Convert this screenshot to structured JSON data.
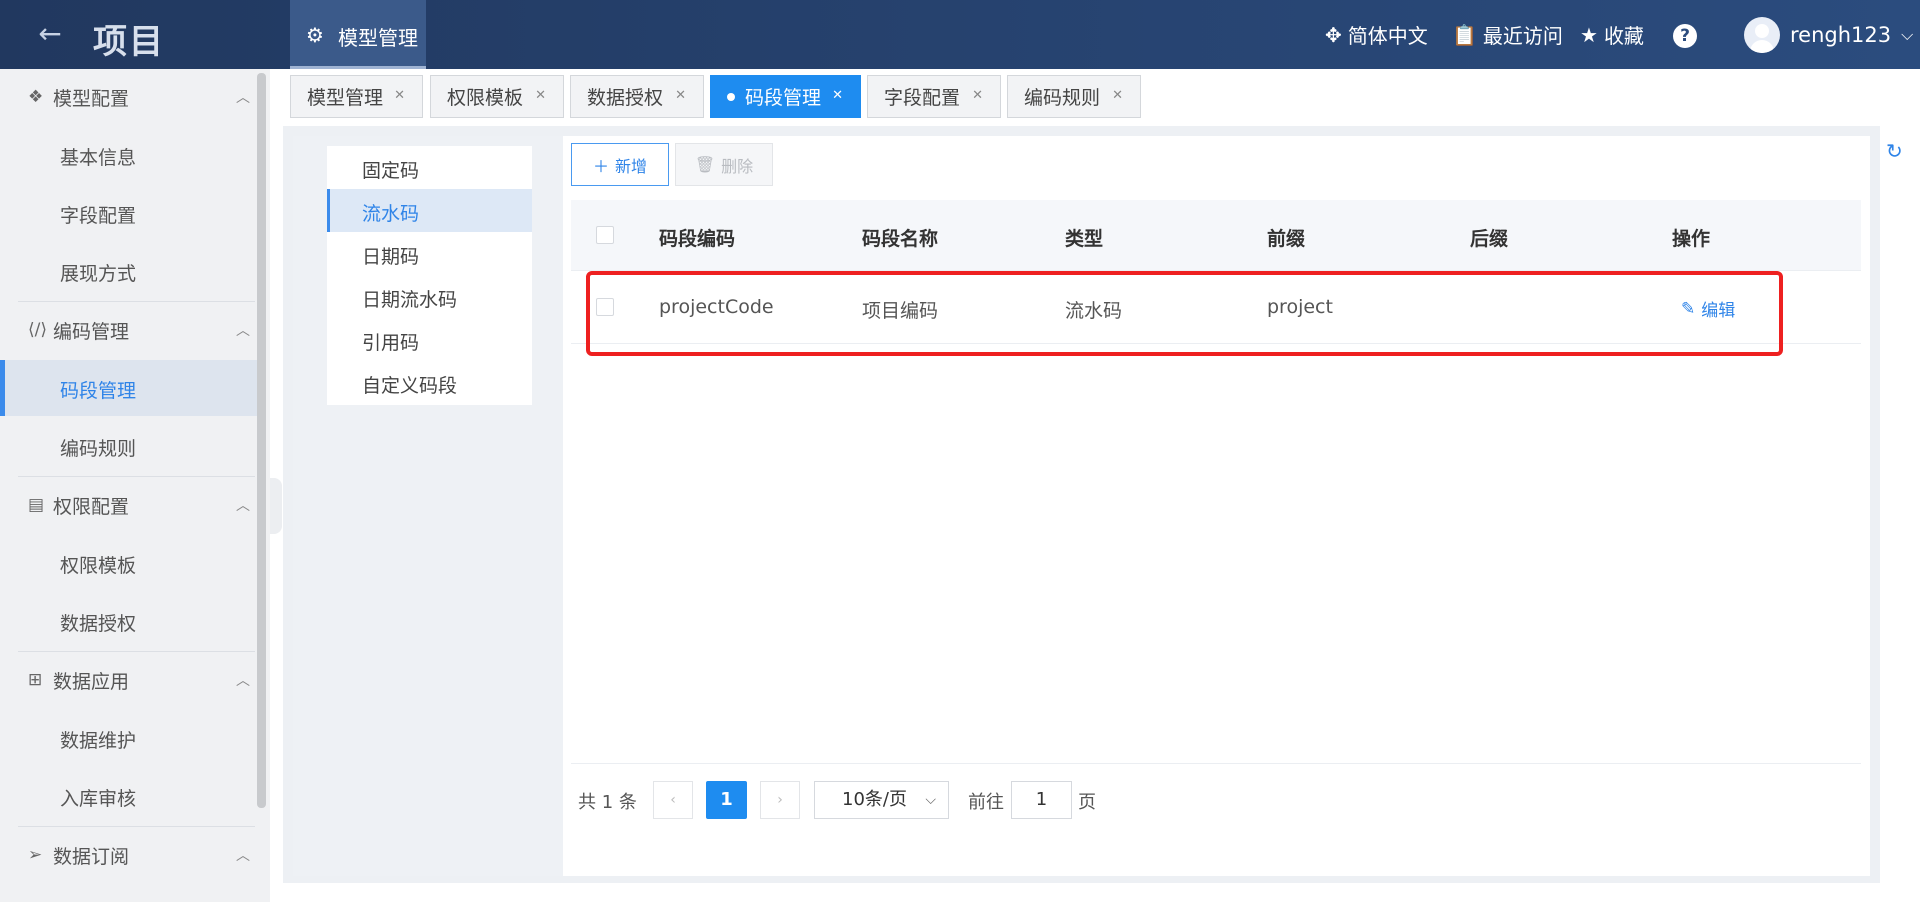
{
  "header": {
    "back_icon": "arrow-left-icon",
    "app_title": "项目",
    "top_tab": "模型管理",
    "language": "简体中文",
    "recent": "最近访问",
    "favorites": "收藏",
    "help": "?",
    "username": "rengh123"
  },
  "sidebar": {
    "groups": [
      {
        "label": "模型配置",
        "icon": "cube-stack-icon",
        "items": [
          "基本信息",
          "字段配置",
          "展现方式"
        ]
      },
      {
        "label": "编码管理",
        "icon": "code-icon",
        "items": [
          "码段管理",
          "编码规则"
        ]
      },
      {
        "label": "权限配置",
        "icon": "permission-doc-icon",
        "items": [
          "权限模板",
          "数据授权"
        ]
      },
      {
        "label": "数据应用",
        "icon": "grid-apps-icon",
        "items": [
          "数据维护",
          "入库审核"
        ]
      },
      {
        "label": "数据订阅",
        "icon": "send-icon",
        "items": []
      }
    ],
    "active_item": "码段管理"
  },
  "tabs": [
    {
      "label": "模型管理",
      "active": false
    },
    {
      "label": "权限模板",
      "active": false
    },
    {
      "label": "数据授权",
      "active": false
    },
    {
      "label": "码段管理",
      "active": true
    },
    {
      "label": "字段配置",
      "active": false
    },
    {
      "label": "编码规则",
      "active": false
    }
  ],
  "code_types": [
    "固定码",
    "流水码",
    "日期码",
    "日期流水码",
    "引用码",
    "自定义码段"
  ],
  "active_code_type": "流水码",
  "toolbar": {
    "add_label": "新增",
    "delete_label": "删除"
  },
  "table": {
    "columns": [
      "码段编码",
      "码段名称",
      "类型",
      "前缀",
      "后缀",
      "操作"
    ],
    "rows": [
      {
        "code": "projectCode",
        "name": "项目编码",
        "type": "流水码",
        "prefix": "project",
        "suffix": "",
        "action": "编辑"
      }
    ]
  },
  "pagination": {
    "total_text": "共 1 条",
    "current_page": "1",
    "page_size": "10条/页",
    "goto_label": "前往",
    "goto_value": "1",
    "page_suffix": "页",
    "prev": "‹",
    "next": "›"
  },
  "colors": {
    "primary": "#1e8cf0",
    "header_bg": "#2b4c7e",
    "highlight_border": "#ee2020"
  }
}
